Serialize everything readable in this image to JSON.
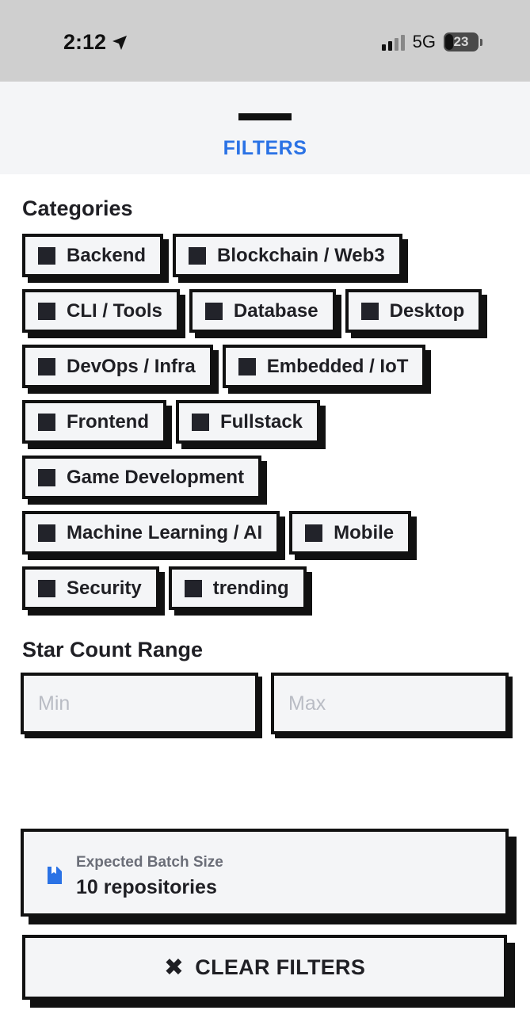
{
  "status_bar": {
    "time": "2:12",
    "network": "5G",
    "battery": "23"
  },
  "header": {
    "title": "FILTERS"
  },
  "categories": {
    "title": "Categories",
    "rows": [
      [
        "Backend",
        "Blockchain / Web3"
      ],
      [
        "CLI / Tools",
        "Database",
        "Desktop"
      ],
      [
        "DevOps / Infra",
        "Embedded / IoT"
      ],
      [
        "Frontend",
        "Fullstack"
      ],
      [
        "Game Development"
      ],
      [
        "Machine Learning / AI",
        "Mobile"
      ],
      [
        "Security",
        "trending"
      ]
    ]
  },
  "star_range": {
    "title": "Star Count Range",
    "min_placeholder": "Min",
    "max_placeholder": "Max"
  },
  "batch": {
    "label": "Expected Batch Size",
    "value": "10 repositories"
  },
  "clear": {
    "label": "CLEAR FILTERS"
  }
}
